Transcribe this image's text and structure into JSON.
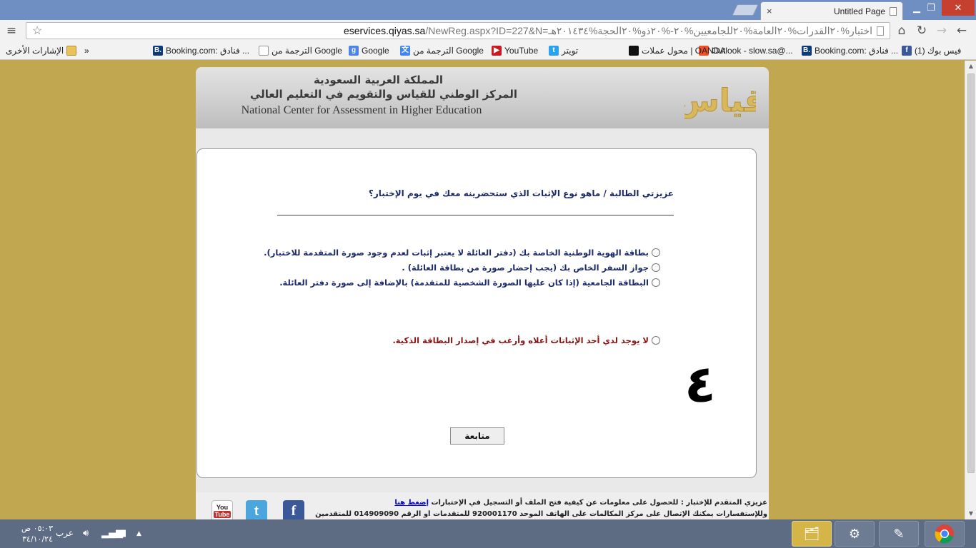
{
  "browser": {
    "tab_title": "Untitled Page",
    "tab_close": "×",
    "window_controls": {
      "minimize": "▁",
      "maximize": "❐",
      "close": "✕"
    },
    "url_host": "eservices.qiyas.sa",
    "url_path": "/NewReg.aspx?ID=227&N=اختبار%٢٠القدرات%٢٠العامة%٢٠للجامعيين%٢٠-%٢٠ذو%٢٠الحجة%٢٠١٤٣٤هـ",
    "nav": {
      "back": "←",
      "forward": "→",
      "reload": "↻",
      "home": "⌂",
      "menu": "≡"
    },
    "bookmarks": [
      {
        "label": "(1) فيس بوك",
        "icon": "facebook-icon",
        "icon_text": "f",
        "color": "#3b5998"
      },
      {
        "label": "Booking.com: فنادق ...",
        "icon": "booking-icon",
        "icon_text": "B.",
        "color": "#0c3a7a"
      },
      {
        "label": "Outlook - slow.sa@...",
        "icon": "windows-icon",
        "icon_text": "",
        "color": "#f25022"
      },
      {
        "label": "محول عملات | OANDA",
        "icon": "oanda-icon",
        "icon_text": "",
        "color": "#111111"
      },
      {
        "label": "تويتر",
        "icon": "twitter-icon",
        "icon_text": "t",
        "color": "#2aa3ef"
      },
      {
        "label": "YouTube",
        "icon": "youtube-icon",
        "icon_text": "▶",
        "color": "#cc181e"
      },
      {
        "label": "الترجمة من Google",
        "icon": "translate-icon",
        "icon_text": "文",
        "color": "#4285f4"
      },
      {
        "label": "Google",
        "icon": "google-icon",
        "icon_text": "g",
        "color": "#4a86e8"
      },
      {
        "label": "الترجمة من Google",
        "icon": "page-icon",
        "icon_text": "",
        "color": "#ffffff"
      },
      {
        "label": "Booking.com: فنادق ...",
        "icon": "booking-icon",
        "icon_text": "B.",
        "color": "#0c3a7a"
      }
    ],
    "bookmarks_more": "»",
    "other_bookmarks": "الإشارات الأخرى"
  },
  "header": {
    "ar_line1": "المملكة العربية السعودية",
    "ar_line2": "المركز الوطني للقياس والتقويم في التعليم العالي",
    "en_line": "National Center for Assessment in Higher Education",
    "logo_text": "قياس"
  },
  "form": {
    "question": "عزيزتي الطالبة /  ماهو نوع الإثبات الذي ستحضرينه معك في يوم الإختبار؟",
    "options": [
      "بطاقة الهوية الوطنية الخاصة بك (دفتر العائلة لا يعتبر إثبات لعدم وجود صورة المتقدمة للاختبار).",
      "جواز السفر الخاص بك (يجب إحضار صورة من بطاقة العائلة) .",
      "البطاقة الجامعية (إذا كان عليها الصورة الشخصية للمتقدمة) بالإضافة إلى صورة دفتر العائلة.",
      "لا يوجد لدي أحد الإثباتات أعلاه وأرغب في إصدار البطاقة الذكية."
    ],
    "handwritten_number": "٤",
    "continue_label": "متابعة"
  },
  "footer": {
    "line1": "عزيزي المتقدم للإختبار : للحصول على معلومات عن كيفية فتح الملف أو التسجيل في الإختبارات ",
    "link": "إضغط هنا",
    "line2": "وللإستفسارات يمكنك الإتصال على مركز المكالمات على الهاتف الموحد 920001170  للمتقدمات أو الرقم 014909090 للمتقدمين",
    "social": {
      "youtube_you": "You",
      "youtube_tube": "Tube",
      "twitter": "t",
      "facebook": "f"
    }
  },
  "taskbar": {
    "time": "٠٥:٠٣ ص",
    "date": "٣٤/١٠/٢٤",
    "language": "عرب",
    "tray_icons": [
      "volume-icon",
      "signal-icon",
      "battery-icon",
      "tray-arrow-icon"
    ],
    "tasks": [
      "file-explorer-icon",
      "control-panel-icon",
      "paint-icon",
      "chrome-icon"
    ]
  }
}
